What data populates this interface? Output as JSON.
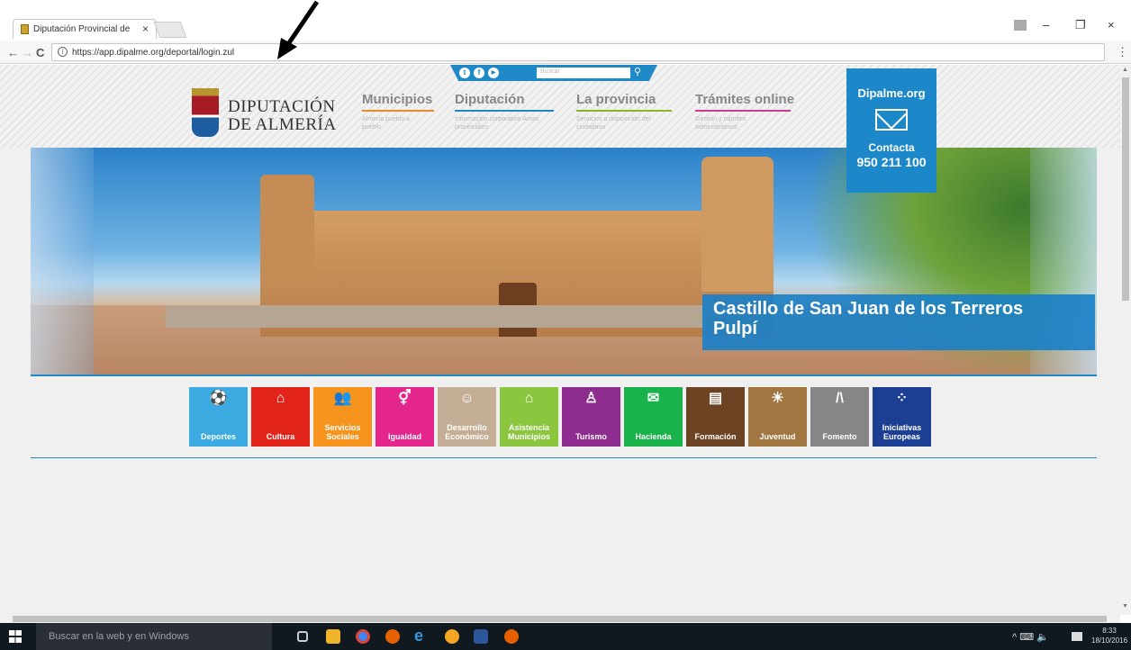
{
  "browser": {
    "tab_title": "Diputación Provincial de",
    "tab_close": "×",
    "url": "https://app.dipalme.org/deportal/login.zul",
    "window_controls": {
      "minimize": "–",
      "restore": "❐",
      "close": "×"
    },
    "nav": {
      "back": "←",
      "forward": "→",
      "reload": "C",
      "info": "i",
      "menu": "⋮"
    }
  },
  "header": {
    "social": [
      "t",
      "f",
      "▶"
    ],
    "search_placeholder": "Buscar",
    "logo": {
      "line1": "DIPUTACIÓN",
      "line2": "DE ALMERÍA"
    },
    "nav_items": [
      {
        "title": "Municipios",
        "sub": "Almería pueblo a pueblo",
        "color": "#e68a2e"
      },
      {
        "title": "Diputación",
        "sub": "Información corporativa Áreas provinciales",
        "color": "#1c87c9"
      },
      {
        "title": "La provincia",
        "sub": "Servicios a disposición del ciudadano",
        "color": "#8bb52a"
      },
      {
        "title": "Trámites online",
        "sub": "Gestión y trámites administrativos",
        "color": "#d33c8c"
      }
    ],
    "contact": {
      "site": "Dipalme.org",
      "label": "Contacta",
      "phone": "950 211 100"
    }
  },
  "hero": {
    "caption_line1": "Castillo de San Juan de los Terreros",
    "caption_line2": "Pulpí"
  },
  "tiles": [
    {
      "label": "Deportes",
      "icon": "⚽",
      "color": "#3aaae0"
    },
    {
      "label": "Cultura",
      "icon": "⌂",
      "color": "#e2231a"
    },
    {
      "label": "Servicios Sociales",
      "icon": "👥",
      "color": "#f7941d"
    },
    {
      "label": "Igualdad",
      "icon": "⚥",
      "color": "#e4258b"
    },
    {
      "label": "Desarrollo Económico",
      "icon": "☺",
      "color": "#c4ae95"
    },
    {
      "label": "Asistencia Municipios",
      "icon": "⌂",
      "color": "#8cc63f"
    },
    {
      "label": "Turismo",
      "icon": "♙",
      "color": "#8e2d8f"
    },
    {
      "label": "Hacienda",
      "icon": "✉",
      "color": "#19b24b"
    },
    {
      "label": "Formación",
      "icon": "▤",
      "color": "#6c4423"
    },
    {
      "label": "Juventud",
      "icon": "☀",
      "color": "#a27641"
    },
    {
      "label": "Fomento",
      "icon": "/\\",
      "color": "#868686"
    },
    {
      "label": "Iniciativas Europeas",
      "icon": "⁘",
      "color": "#1c3f94"
    }
  ],
  "taskbar": {
    "search": "Buscar en la web y en Windows",
    "time": "8:33",
    "date": "18/10/2016",
    "tray": "^ ⌨ 🔈"
  }
}
